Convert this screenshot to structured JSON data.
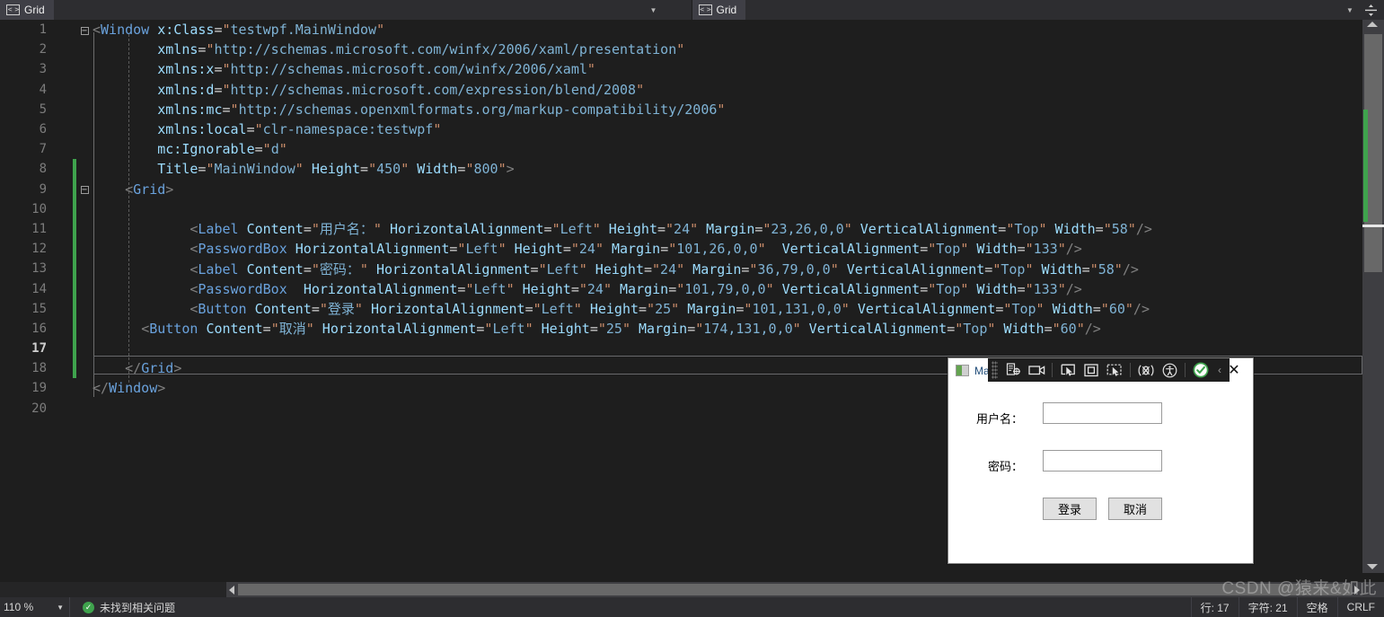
{
  "tabs": [
    {
      "label": "Grid",
      "icon": "xaml-code-icon"
    },
    {
      "label": "Grid",
      "icon": "xaml-code-icon"
    }
  ],
  "editor": {
    "current_line": 17,
    "total_lines_shown": 20,
    "lines": [
      {
        "n": "1",
        "changed": false,
        "fold": "minus",
        "text": "<Window x:Class=\"testwpf.MainWindow\""
      },
      {
        "n": "2",
        "changed": false,
        "fold": "",
        "text": "        xmlns=\"http://schemas.microsoft.com/winfx/2006/xaml/presentation\""
      },
      {
        "n": "3",
        "changed": false,
        "fold": "",
        "text": "        xmlns:x=\"http://schemas.microsoft.com/winfx/2006/xaml\""
      },
      {
        "n": "4",
        "changed": false,
        "fold": "",
        "text": "        xmlns:d=\"http://schemas.microsoft.com/expression/blend/2008\""
      },
      {
        "n": "5",
        "changed": false,
        "fold": "",
        "text": "        xmlns:mc=\"http://schemas.openxmlformats.org/markup-compatibility/2006\""
      },
      {
        "n": "6",
        "changed": false,
        "fold": "",
        "text": "        xmlns:local=\"clr-namespace:testwpf\""
      },
      {
        "n": "7",
        "changed": false,
        "fold": "",
        "text": "        mc:Ignorable=\"d\""
      },
      {
        "n": "8",
        "changed": true,
        "fold": "",
        "text": "        Title=\"MainWindow\" Height=\"450\" Width=\"800\">"
      },
      {
        "n": "9",
        "changed": true,
        "fold": "minus",
        "text": "    <Grid>"
      },
      {
        "n": "10",
        "changed": true,
        "fold": "",
        "text": ""
      },
      {
        "n": "11",
        "changed": true,
        "fold": "",
        "text": "            <Label Content=\"用户名：\" HorizontalAlignment=\"Left\" Height=\"24\" Margin=\"23,26,0,0\" VerticalAlignment=\"Top\" Width=\"58\"/>"
      },
      {
        "n": "12",
        "changed": true,
        "fold": "",
        "text": "            <PasswordBox HorizontalAlignment=\"Left\" Height=\"24\" Margin=\"101,26,0,0\"  VerticalAlignment=\"Top\" Width=\"133\"/>"
      },
      {
        "n": "13",
        "changed": true,
        "fold": "",
        "text": "            <Label Content=\"密码：\" HorizontalAlignment=\"Left\" Height=\"24\" Margin=\"36,79,0,0\" VerticalAlignment=\"Top\" Width=\"58\"/>"
      },
      {
        "n": "14",
        "changed": true,
        "fold": "",
        "text": "            <PasswordBox  HorizontalAlignment=\"Left\" Height=\"24\" Margin=\"101,79,0,0\" VerticalAlignment=\"Top\" Width=\"133\"/>"
      },
      {
        "n": "15",
        "changed": true,
        "fold": "",
        "text": "            <Button Content=\"登录\" HorizontalAlignment=\"Left\" Height=\"25\" Margin=\"101,131,0,0\" VerticalAlignment=\"Top\" Width=\"60\"/>"
      },
      {
        "n": "16",
        "changed": true,
        "fold": "",
        "text": "      <Button Content=\"取消\" HorizontalAlignment=\"Left\" Height=\"25\" Margin=\"174,131,0,0\" VerticalAlignment=\"Top\" Width=\"60\"/>"
      },
      {
        "n": "17",
        "changed": true,
        "fold": "",
        "text": ""
      },
      {
        "n": "18",
        "changed": true,
        "fold": "",
        "text": "    </Grid>"
      },
      {
        "n": "19",
        "changed": false,
        "fold": "",
        "text": "</Window>"
      },
      {
        "n": "20",
        "changed": false,
        "fold": "",
        "text": ""
      }
    ]
  },
  "inapp_toolbar": {
    "buttons": [
      {
        "name": "go-to-live-visual-tree-icon",
        "glyph": "live-tree"
      },
      {
        "name": "screen-capture-icon",
        "glyph": "camera"
      },
      {
        "name": "select-element-icon",
        "glyph": "cursor-screen"
      },
      {
        "name": "display-layout-adorners-icon",
        "glyph": "square-in-square"
      },
      {
        "name": "track-focused-element-icon",
        "glyph": "dashed-cursor"
      },
      {
        "name": "xaml-hot-reload-icon",
        "glyph": "hot-reload"
      },
      {
        "name": "accessibility-checker-icon",
        "glyph": "accessibility"
      },
      {
        "name": "live-visual-tree-status-icon",
        "glyph": "check-circle"
      }
    ],
    "collapse_label": "‹"
  },
  "app_window": {
    "title": "MainWindow",
    "close_label": "✕",
    "username_label": "用户名：",
    "password_label": "密码：",
    "username_value": "",
    "password_value": "",
    "login_button": "登录",
    "cancel_button": "取消"
  },
  "statusbar": {
    "zoom": "110 %",
    "issues": "未找到相关问题",
    "line": "行: 17",
    "column": "字符: 21",
    "indent": "空格",
    "eol": "CRLF"
  },
  "watermark": "CSDN @猿来&如此",
  "colors": {
    "editor_bg": "#1e1e1e",
    "chrome_bg": "#2d2d30",
    "tab_active": "#3f3f46",
    "tag": "#6aa2dd",
    "attr": "#9cdcfe",
    "string": "#cc8e6b",
    "changebar_green": "#3fa34d",
    "link_blue": "#1e4b78"
  }
}
